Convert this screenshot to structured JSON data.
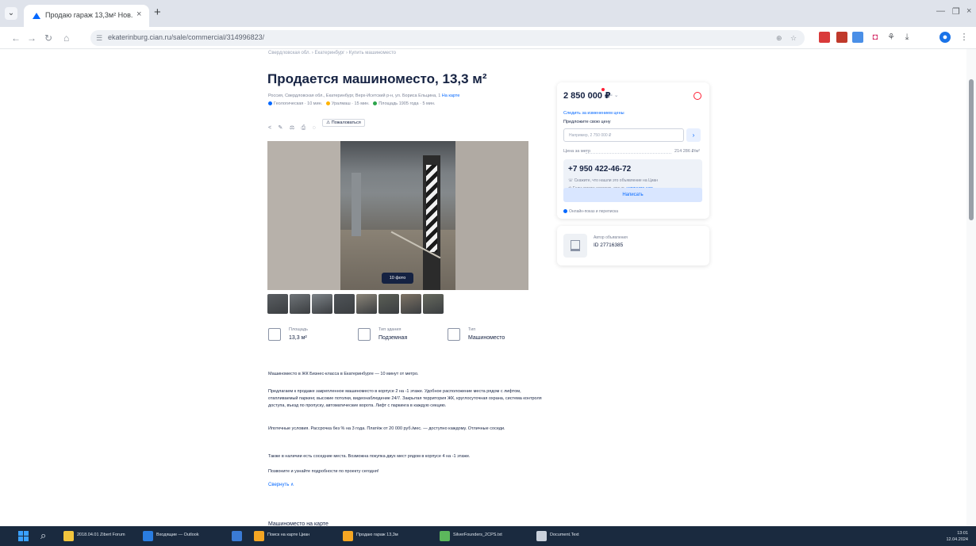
{
  "browser": {
    "tab_title": "Продаю гараж 13,3м² Нов...",
    "url": "ekaterinburg.cian.ru/sale/commercial/314996823/",
    "colors": {
      "tabbar": "#dfe3eb",
      "accent": "#0468ff",
      "profile": "#1a73e8"
    }
  },
  "listing": {
    "breadcrumbs": "Свердловская обл. › Екатеринбург › Купить машиноместо",
    "title": "Продается машиноместо, 13,3 м²",
    "address": "Россия, Свердловская обл., Екатеринбург, Верх-Исетский р-н, ул. Бориса Ельцина, 1",
    "address_more": "На карте",
    "metro": [
      {
        "name": "Геологическая",
        "time": "10 мин.",
        "color": "#0468ff"
      },
      {
        "name": "Уралмаш",
        "time": "15 мин.",
        "color": "#ffb300"
      },
      {
        "name": "Площадь 1905 года",
        "time": "5 мин.",
        "color": "#2ca44b"
      }
    ],
    "actions": {
      "complain_label": "Пожаловаться"
    },
    "photo_badge": "10 фото",
    "thumb_colors": [
      "#5a5e62",
      "#6f7478",
      "#7c8287",
      "#4f5458",
      "#8a8478",
      "#5b5f56",
      "#7d7365",
      "#66695e"
    ],
    "features": [
      {
        "label": "Площадь",
        "value": "13,3 м²",
        "icon": "area-icon"
      },
      {
        "label": "Тип здания",
        "value": "Подземная",
        "icon": "building-icon"
      },
      {
        "label": "Тип",
        "value": "Машиноместо",
        "icon": "parking-icon"
      }
    ],
    "description": [
      "Машиноместо в ЖК Бизнес-класса в Екатеринбурге — 10 минут от метро.",
      "Предлагаем к продаже закрепленное машиноместо в корпусе 2 на -1 этаже. Удобное расположение места рядом с лифтом, отапливаемый паркинг, высокие потолки, видеонаблюдение 24/7. Закрытая территория ЖК, круглосуточная охрана, система контроля доступа, въезд по пропуску, автоматические ворота. Лифт с паркинга в каждую секцию.",
      "Ипотечные условия. Рассрочка без % на 3 года. Платёж от 20 000 руб./мес. — доступно каждому. Отличные соседи.",
      "Также в наличии есть соседние места. Возможна покупка двух мест рядом в корпусе 4 на -1 этаже.",
      "Позвоните и узнайте подробности по проекту сегодня!"
    ],
    "description_more": "Свернуть ∧",
    "next_heading": "Машиноместо на карте"
  },
  "price_card": {
    "price": "2 850 000 ₽",
    "price_suffix": "≈ ⌄",
    "link": "Следить за изменением цены",
    "offer_label": "Предложите свою цену",
    "offer_placeholder": "Например, 2 750 000 ₽",
    "offer_button": "›",
    "row_label": "Цена за метр",
    "row_value": "214 286 ₽/м²",
    "phone": "+7 950 422-46-72",
    "note1": "Скажите, что нашли это объявление на Циан",
    "note2": "Если хотите оставить отзыв,",
    "note2_link": "напишите нам",
    "write_button": "Написать",
    "online": "Онлайн-показ и переписка"
  },
  "author": {
    "label": "Автор объявления",
    "id": "ID 27716385"
  },
  "taskbar": {
    "items": [
      {
        "label": "2018.04.01 Zibert Forum",
        "color": "#f2c53d"
      },
      {
        "label": "Входящие — Outlook",
        "color": "#2a7de1"
      },
      {
        "label": "",
        "color": "#3a7bd5"
      },
      {
        "label": "Поиск на карте Циан",
        "color": "#f5a623"
      },
      {
        "label": "Продаю гараж 13,3м",
        "color": "#f5a623"
      },
      {
        "label": "SilverFounders_2CPS.txt",
        "color": "#5cb85c"
      },
      {
        "label": "Document.Text",
        "color": "#c9d1dc"
      }
    ],
    "time": "13:01",
    "date": "12.04.2024"
  }
}
